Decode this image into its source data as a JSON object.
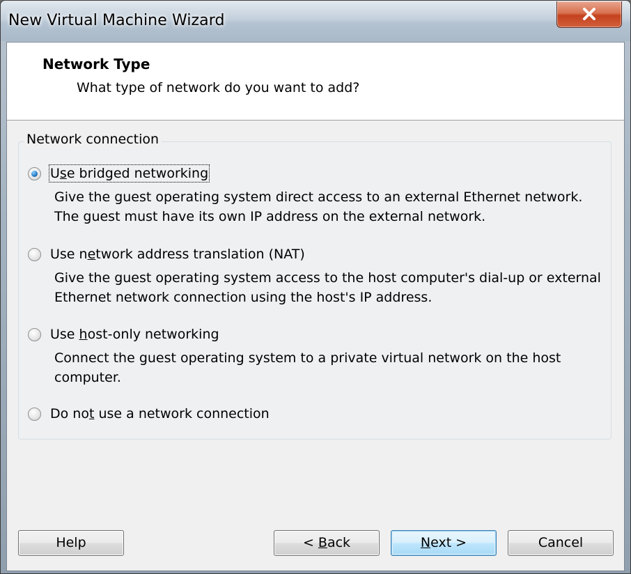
{
  "window": {
    "title": "New Virtual Machine Wizard",
    "close_icon": "close-x-icon"
  },
  "header": {
    "title": "Network Type",
    "subtitle": "What type of network do you want to add?"
  },
  "network_group": {
    "legend": "Network connection",
    "selected": "bridged",
    "options": [
      {
        "id": "bridged",
        "label_pre": "U",
        "label_accel": "s",
        "label_post": "e bridged networking",
        "description": "Give the guest operating system direct access to an external Ethernet network. The guest must have its own IP address on the external network."
      },
      {
        "id": "nat",
        "label_pre": "Use n",
        "label_accel": "e",
        "label_post": "twork address translation (NAT)",
        "description": "Give the guest operating system access to the host computer's dial-up or external Ethernet network connection using the host's IP address."
      },
      {
        "id": "host-only",
        "label_pre": "Use ",
        "label_accel": "h",
        "label_post": "ost-only networking",
        "description": "Connect the guest operating system to a private virtual network on the host computer."
      },
      {
        "id": "none",
        "label_pre": "Do no",
        "label_accel": "t",
        "label_post": " use a network connection",
        "description": ""
      }
    ]
  },
  "buttons": {
    "help": "Help",
    "back_pre": "< ",
    "back_accel": "B",
    "back_post": "ack",
    "next_pre": "",
    "next_accel": "N",
    "next_post": "ext >",
    "cancel": "Cancel"
  },
  "colors": {
    "accent_blue": "#3c7fb1",
    "close_red": "#c4411e",
    "dialog_bg": "#f0f0f0"
  }
}
